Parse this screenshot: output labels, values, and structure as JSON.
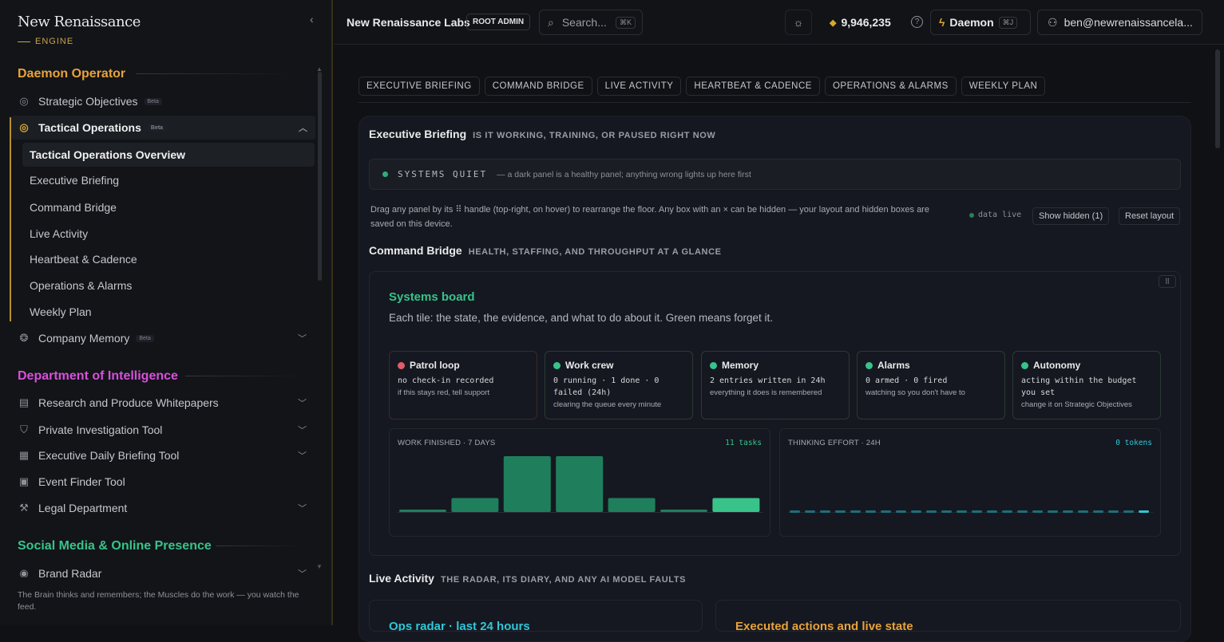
{
  "brand": {
    "name": "New Renaissance",
    "sub": "ENGINE"
  },
  "sidebar": {
    "sections": [
      {
        "title": "Daemon Operator",
        "color": "#e8a23a"
      },
      {
        "title": "Department of Intelligence",
        "color": "#d94fdb"
      },
      {
        "title": "Social Media & Online Presence",
        "color": "#37c38a"
      }
    ],
    "items": [
      {
        "label": "Strategic Objectives",
        "badge": "Beta",
        "icon": "target-icon"
      },
      {
        "label": "Tactical Operations",
        "badge": "Beta",
        "icon": "target-icon"
      },
      {
        "label": "Company Memory",
        "badge": "Beta",
        "icon": "brain-icon"
      },
      {
        "label": "Research and Produce Whitepapers",
        "icon": "document-icon"
      },
      {
        "label": "Private Investigation Tool",
        "icon": "shield-icon"
      },
      {
        "label": "Executive Daily Briefing Tool",
        "icon": "newspaper-icon"
      },
      {
        "label": "Event Finder Tool",
        "icon": "calendar-icon"
      },
      {
        "label": "Legal Department",
        "icon": "gavel-icon"
      },
      {
        "label": "Brand Radar",
        "icon": "radar-icon"
      }
    ],
    "sub_items": [
      "Tactical Operations Overview",
      "Executive Briefing",
      "Command Bridge",
      "Live Activity",
      "Heartbeat & Cadence",
      "Operations & Alarms",
      "Weekly Plan"
    ],
    "footer": "The Brain thinks and remembers; the Muscles do the work — you watch the feed."
  },
  "topbar": {
    "org": "New Renaissance Labs",
    "role_badge": "ROOT ADMIN",
    "search_placeholder": "Search...",
    "search_kbd": "⌘K",
    "balance": "9,946,235",
    "daemon_label": "Daemon",
    "daemon_kbd": "⌘J",
    "user": "ben@newrenaissancela..."
  },
  "tabs": [
    "EXECUTIVE BRIEFING",
    "COMMAND BRIDGE",
    "LIVE ACTIVITY",
    "HEARTBEAT & CADENCE",
    "OPERATIONS & ALARMS",
    "WEEKLY PLAN"
  ],
  "briefing": {
    "title": "Executive Briefing",
    "subtitle": "IS IT WORKING, TRAINING, OR PAUSED RIGHT NOW",
    "status_label": "SYSTEMS QUIET",
    "status_desc": "— a dark panel is a healthy panel; anything wrong lights up here first",
    "hint": "Drag any panel by its ⠿ handle (top-right, on hover) to rearrange the floor. Any box with an × can be hidden — your layout and hidden boxes are saved on this device.",
    "data_live": "data live",
    "show_hidden": "Show hidden (1)",
    "reset_layout": "Reset layout"
  },
  "bridge": {
    "title": "Command Bridge",
    "subtitle": "HEALTH, STAFFING, AND THROUGHPUT AT A GLANCE",
    "board_title": "Systems board",
    "board_desc": "Each tile: the state, the evidence, and what to do about it. Green means forget it.",
    "grip": "⠿",
    "tiles": [
      {
        "name": "Patrol loop",
        "state": "no check-in recorded",
        "note": "if this stays red, tell support",
        "status": "red"
      },
      {
        "name": "Work crew",
        "state": "0 running · 1 done · 0 failed (24h)",
        "note": "clearing the queue every minute",
        "status": "green"
      },
      {
        "name": "Memory",
        "state": "2 entries written in 24h",
        "note": "everything it does is remembered",
        "status": "green"
      },
      {
        "name": "Alarms",
        "state": "0 armed · 0 fired",
        "note": "watching so you don't have to",
        "status": "green"
      },
      {
        "name": "Autonomy",
        "state": "acting within the budget you set",
        "note": "change it on Strategic Objectives",
        "status": "green"
      }
    ],
    "work_label": "WORK FINISHED · 7 DAYS",
    "work_meta": "11 tasks",
    "effort_label": "THINKING EFFORT · 24H",
    "effort_meta": "0 tokens"
  },
  "chart_data": [
    {
      "type": "bar",
      "title": "WORK FINISHED · 7 DAYS",
      "values": [
        0,
        2,
        8,
        8,
        2,
        0,
        2
      ],
      "highlight_last": true,
      "annotation": "11 tasks"
    },
    {
      "type": "bar",
      "title": "THINKING EFFORT · 24H",
      "values": [
        0,
        0,
        0,
        0,
        0,
        0,
        0,
        0,
        0,
        0,
        0,
        0,
        0,
        0,
        0,
        0,
        0,
        0,
        0,
        0,
        0,
        0,
        0,
        0
      ],
      "annotation": "0 tokens"
    }
  ],
  "live": {
    "title": "Live Activity",
    "subtitle": "THE RADAR, ITS DIARY, AND ANY AI MODEL FAULTS",
    "card_left": "Ops radar · last 24 hours",
    "card_right": "Executed actions and live state"
  },
  "colors": {
    "accent_gold": "#caa14a",
    "green": "#37c38a",
    "red": "#e05c6a",
    "cyan": "#2fc6d8"
  }
}
